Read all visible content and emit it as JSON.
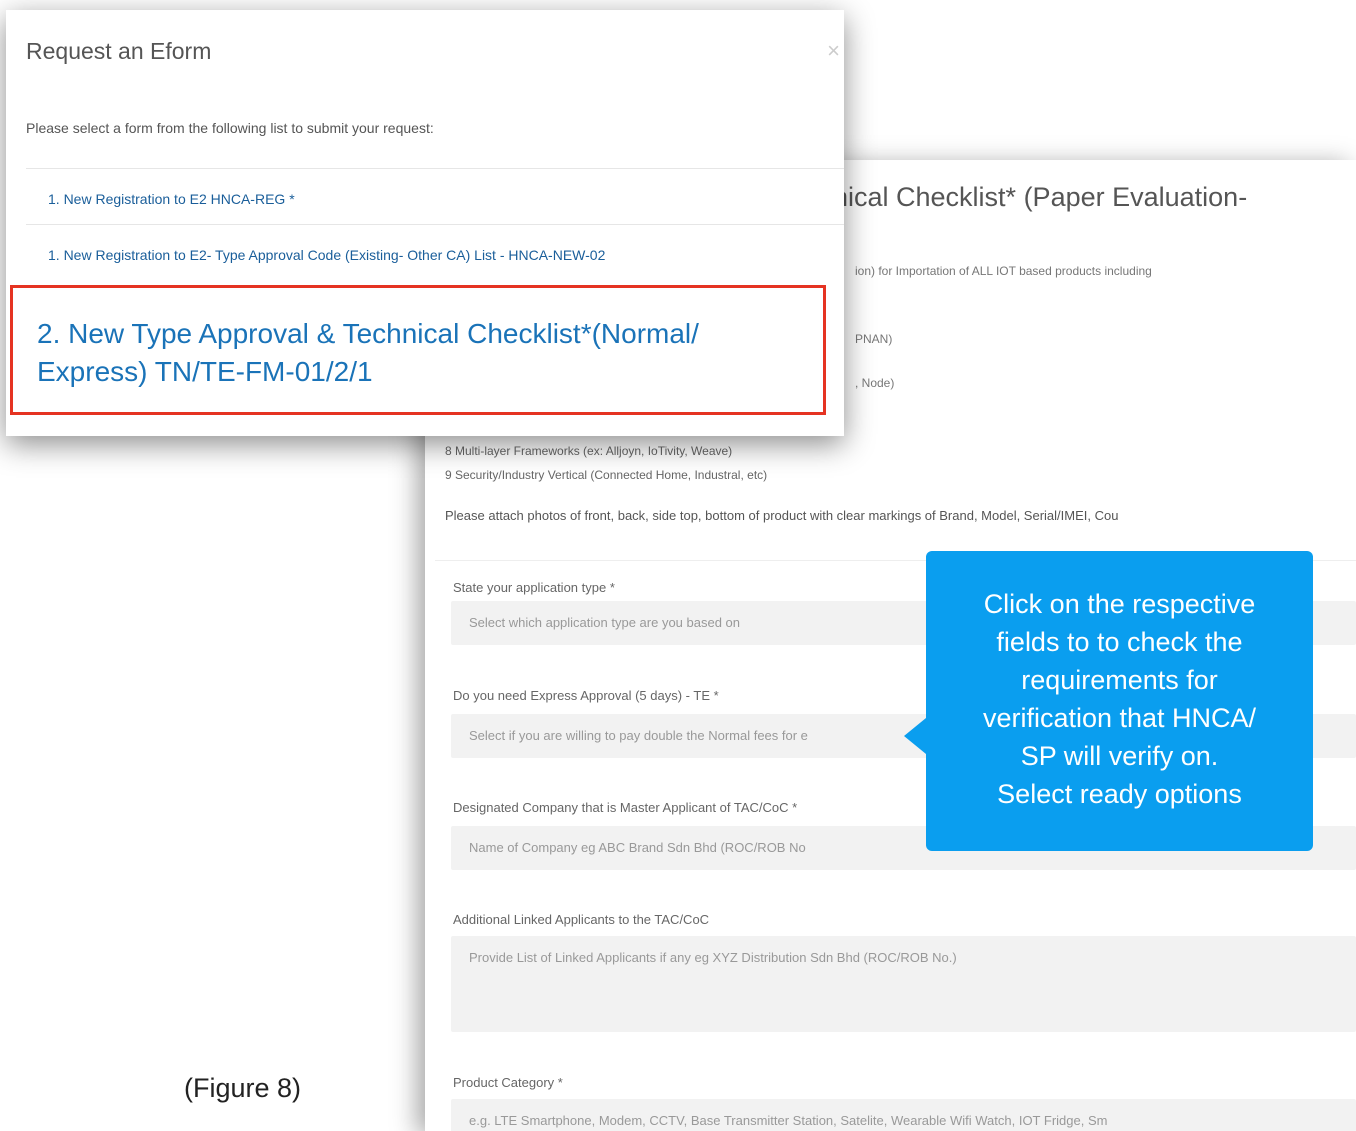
{
  "form": {
    "title": "nical Checklist* (Paper Evaluation-",
    "snippets": [
      "ion) for Importation of ALL IOT based products including",
      "PNAN)",
      ", Node)"
    ],
    "list_items": [
      "8 Multi-layer Frameworks (ex: Alljoyn, IoTivity, Weave)",
      "9 Security/Industry Vertical (Connected Home, Industral, etc)"
    ],
    "attach_note": "Please attach photos of front, back, side top, bottom of product with clear markings of Brand, Model, Serial/IMEI, Cou",
    "fields": [
      {
        "label": "State your application type *",
        "placeholder": "Select which application type are you based on"
      },
      {
        "label": "Do you need Express Approval (5 days) - TE *",
        "placeholder": "Select if you are willing to pay double the Normal fees for e"
      },
      {
        "label": "Designated Company that is Master Applicant of TAC/CoC *",
        "placeholder": "Name of Company eg ABC Brand Sdn Bhd (ROC/ROB No"
      },
      {
        "label": "Additional Linked Applicants to the TAC/CoC",
        "placeholder": "Provide List of Linked Applicants if any eg XYZ Distribution Sdn Bhd (ROC/ROB No.)"
      },
      {
        "label": "Product Category *",
        "placeholder": "e.g. LTE Smartphone, Modem, CCTV, Base Transmitter Station, Satelite, Wearable Wifi Watch, IOT Fridge, Sm"
      }
    ]
  },
  "modal": {
    "title": "Request an Eform",
    "close": "×",
    "intro": "Please select a form from the following list to submit your request:",
    "options": [
      "1. New Registration to E2 HNCA-REG *",
      "1. New Registration to E2- Type Approval Code (Existing- Other CA) List - HNCA-NEW-02"
    ],
    "highlighted": {
      "line1": "2. New Type Approval & Technical Checklist*(Normal/",
      "line2": "Express) TN/TE-FM-01/2/1"
    }
  },
  "tooltip": {
    "lines": [
      "Click on the respective",
      "fields to to check the",
      "requirements for",
      "verification that HNCA/",
      "SP will verify on.",
      "Select ready options"
    ]
  },
  "caption": "(Figure 8)",
  "colors": {
    "highlight_border": "#e53322",
    "link": "#1a73b8",
    "tooltip_bg": "#0a9eef"
  }
}
